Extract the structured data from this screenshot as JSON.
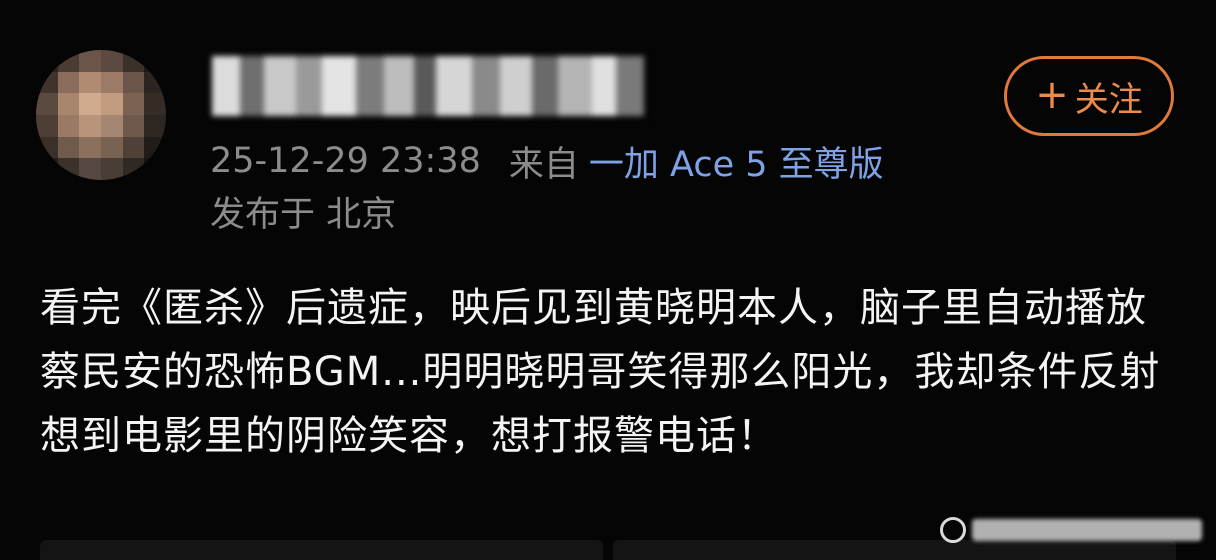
{
  "post": {
    "meta": {
      "timestamp": "25-12-29 23:38",
      "source_prefix": "来自",
      "device": "一加 Ace 5 至尊版"
    },
    "location": "发布于 北京",
    "follow_button": {
      "plus": "+",
      "label": "关注"
    },
    "text": "看完《匿杀》后遗症，映后见到黄晓明本人，脑子里自动播放蔡民安的恐怖BGM...明明晓明哥笑得那么阳光，我却条件反射想到电影里的阴险笑容，想打报警电话！"
  },
  "colors": {
    "background": "#050505",
    "meta_text": "#8c8c8c",
    "device_link": "#7ea2e6",
    "follow_accent": "#e07a3c",
    "body_text": "#f4f4f4"
  },
  "icons": {
    "avatar": "pixelated-avatar",
    "username": "blurred-username",
    "watermark": "watermark-logo"
  }
}
